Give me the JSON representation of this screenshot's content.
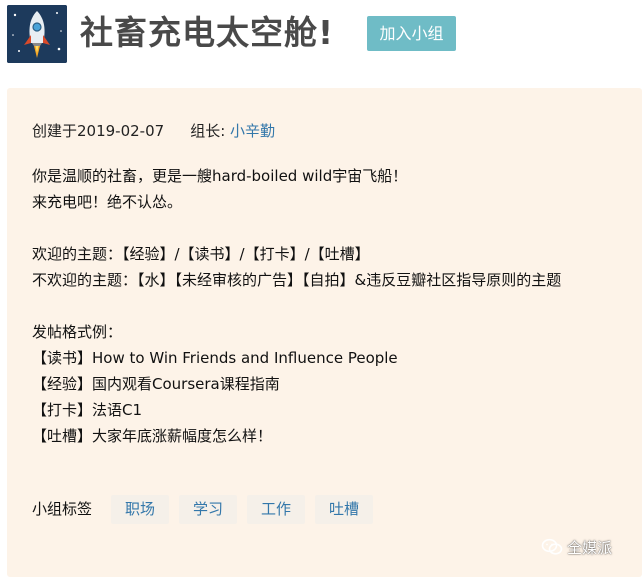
{
  "group": {
    "title": "社畜充电太空舱!",
    "join_label": "加入小组"
  },
  "meta": {
    "created": "创建于2019-02-07",
    "leader_label": "组长:",
    "leader_name": "小辛勤"
  },
  "description": {
    "lines": [
      "你是温顺的社畜，更是一艘hard-boiled wild宇宙飞船！",
      "来充电吧！绝不认怂。",
      "",
      "欢迎的主题：【经验】/【读书】/【打卡】/【吐槽】",
      "不欢迎的主题：【水】【未经审核的广告】【自拍】&违反豆瓣社区指导原则的主题",
      "",
      "发帖格式例：",
      "【读书】How to Win Friends and Influence People",
      "【经验】国内观看Coursera课程指南",
      "【打卡】法语C1",
      "【吐槽】大家年底涨薪幅度怎么样！"
    ]
  },
  "tags": {
    "label": "小组标签",
    "items": [
      "职场",
      "学习",
      "工作",
      "吐槽"
    ]
  },
  "watermark": "全媒派",
  "colors": {
    "join_button": "#6fbcc6",
    "card_background": "#fdf3e8",
    "link": "#3377aa",
    "title": "#494949"
  },
  "icons": {
    "logo": "rocket-icon",
    "watermark": "wechat-icon"
  }
}
